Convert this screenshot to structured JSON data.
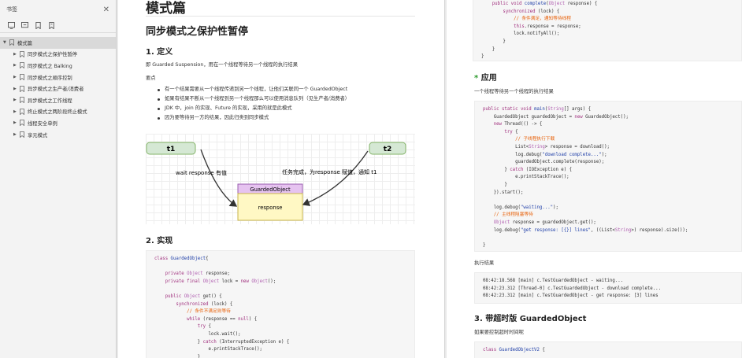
{
  "sidebar": {
    "title": "书签",
    "items": [
      {
        "label": "模式篇",
        "level": 0,
        "selected": true
      },
      {
        "label": "同步模式之保护性暂停",
        "level": 1
      },
      {
        "label": "同步模式之 Balking",
        "level": 1
      },
      {
        "label": "同步模式之顺序控制",
        "level": 1
      },
      {
        "label": "异步模式之生产者/消费者",
        "level": 1
      },
      {
        "label": "异步模式之工作线程",
        "level": 1
      },
      {
        "label": "终止模式之两阶段终止模式",
        "level": 1
      },
      {
        "label": "线程安全单例",
        "level": 1
      },
      {
        "label": "享元模式",
        "level": 1
      }
    ]
  },
  "left": {
    "h1": "模式篇",
    "h2": "同步模式之保护性暂停",
    "def_title": "1. 定义",
    "def_text": "即 Guarded Suspension，用在一个线程等待另一个线程的执行结果",
    "points_title": "要点",
    "bullets": [
      "有一个结果需要从一个线程传递到另一个线程，让他们关联同一个 GuardedObject",
      "如果有结果不断从一个线程到另一个线程那么可以使用消息队列（见生产者/消费者）",
      "JDK 中，join 的实现、Future 的实现，采用的就是此模式",
      "因为要等待另一方的结果，因此归类到同步模式"
    ],
    "impl_title": "2. 实现"
  },
  "diagram": {
    "t1": "t1",
    "t2": "t2",
    "class_name": "GuardedObject",
    "field": "response",
    "left_label": "wait response 有值",
    "right_label": "任务完成，为response 赋值，通知 t1"
  },
  "code_left": [
    [
      [
        "kw",
        "class "
      ],
      [
        "fn",
        "GuardedObject"
      ],
      [
        "",
        "{"
      ]
    ],
    [
      [
        "",
        ""
      ]
    ],
    [
      [
        "",
        "    "
      ],
      [
        "kw",
        "private "
      ],
      [
        "ty",
        "Object "
      ],
      [
        "",
        "response;"
      ]
    ],
    [
      [
        "",
        "    "
      ],
      [
        "kw",
        "private final "
      ],
      [
        "ty",
        "Object "
      ],
      [
        "",
        "lock = "
      ],
      [
        "kw",
        "new "
      ],
      [
        "ty",
        "Object"
      ],
      [
        "",
        "();"
      ]
    ],
    [
      [
        "",
        ""
      ]
    ],
    [
      [
        "",
        "    "
      ],
      [
        "kw",
        "public "
      ],
      [
        "ty",
        "Object "
      ],
      [
        "",
        "get() {"
      ]
    ],
    [
      [
        "",
        "        "
      ],
      [
        "kw",
        "synchronized "
      ],
      [
        "",
        "(lock) {"
      ]
    ],
    [
      [
        "",
        "            "
      ],
      [
        "cm",
        "// 条件不满足则等待"
      ]
    ],
    [
      [
        "",
        "            "
      ],
      [
        "kw",
        "while "
      ],
      [
        "",
        "(response == "
      ],
      [
        "kw",
        "null"
      ],
      [
        "",
        ") {"
      ]
    ],
    [
      [
        "",
        "                "
      ],
      [
        "kw",
        "try "
      ],
      [
        "",
        "{"
      ]
    ],
    [
      [
        "",
        "                    lock.wait();"
      ]
    ],
    [
      [
        "",
        "                } "
      ],
      [
        "kw",
        "catch "
      ],
      [
        "",
        "(InterruptedException e) {"
      ]
    ],
    [
      [
        "",
        "                    e.printStackTrace();"
      ]
    ],
    [
      [
        "",
        "                }"
      ]
    ]
  ],
  "right": {
    "app_title": "应用",
    "app_text": "一个线程等待另一个线程的执行结果",
    "result_label": "执行结果",
    "timeout_title": "3. 带超时版 GuardedObject",
    "timeout_text": "如果要控制超时时间呢"
  },
  "code_right_top": [
    [
      [
        "",
        "    "
      ],
      [
        "kw",
        "public void "
      ],
      [
        "fn",
        "complete"
      ],
      [
        "",
        "("
      ],
      [
        "ty",
        "Object "
      ],
      [
        "",
        "response) {"
      ]
    ],
    [
      [
        "",
        "        "
      ],
      [
        "kw",
        "synchronized "
      ],
      [
        "",
        "(lock) {"
      ]
    ],
    [
      [
        "",
        "            "
      ],
      [
        "cm",
        "// 条件满足，通知等待线程"
      ]
    ],
    [
      [
        "",
        "            "
      ],
      [
        "kw",
        "this"
      ],
      [
        "",
        ".response = response;"
      ]
    ],
    [
      [
        "",
        "            lock.notifyAll();"
      ]
    ],
    [
      [
        "",
        "        }"
      ]
    ],
    [
      [
        "",
        "    }"
      ]
    ],
    [
      [
        "",
        "}"
      ]
    ]
  ],
  "code_right_app": [
    [
      [
        "kw",
        "public static void "
      ],
      [
        "fn",
        "main"
      ],
      [
        "",
        "("
      ],
      [
        "ty",
        "String"
      ],
      [
        "",
        "[] args) {"
      ]
    ],
    [
      [
        "",
        "    GuardedObject guardedObject = "
      ],
      [
        "kw",
        "new "
      ],
      [
        "",
        "GuardedObject();"
      ]
    ],
    [
      [
        "",
        "    "
      ],
      [
        "kw",
        "new "
      ],
      [
        "",
        "Thread(() -> {"
      ]
    ],
    [
      [
        "",
        "        "
      ],
      [
        "kw",
        "try "
      ],
      [
        "",
        "{"
      ]
    ],
    [
      [
        "",
        "            "
      ],
      [
        "cm",
        "// 子线程执行下载"
      ]
    ],
    [
      [
        "",
        "            List<"
      ],
      [
        "ty",
        "String"
      ],
      [
        "",
        "> response = download();"
      ]
    ],
    [
      [
        "",
        "            log.debug("
      ],
      [
        "st",
        "\"download complete...\""
      ],
      [
        "",
        ");"
      ]
    ],
    [
      [
        "",
        "            guardedObject.complete(response);"
      ]
    ],
    [
      [
        "",
        "        } "
      ],
      [
        "kw",
        "catch "
      ],
      [
        "",
        "(IOException e) {"
      ]
    ],
    [
      [
        "",
        "            e.printStackTrace();"
      ]
    ],
    [
      [
        "",
        "        }"
      ]
    ],
    [
      [
        "",
        "    }).start();"
      ]
    ],
    [
      [
        "",
        ""
      ]
    ],
    [
      [
        "",
        "    log.debug("
      ],
      [
        "st",
        "\"waiting...\""
      ],
      [
        "",
        ");"
      ]
    ],
    [
      [
        "",
        "    "
      ],
      [
        "cm",
        "// 主线程阻塞等待"
      ]
    ],
    [
      [
        "",
        "    "
      ],
      [
        "ty",
        "Object "
      ],
      [
        "",
        "response = guardedObject.get();"
      ]
    ],
    [
      [
        "",
        "    log.debug("
      ],
      [
        "st",
        "\"get response: [{}] lines\""
      ],
      [
        "",
        ", ((List<"
      ],
      [
        "ty",
        "String"
      ],
      [
        "",
        ">) response).size());"
      ]
    ],
    [
      [
        "",
        ""
      ]
    ],
    [
      [
        "",
        "}"
      ]
    ]
  ],
  "output_lines": [
    "08:42:18.568 [main] c.TestGuardedObject - waiting...",
    "08:42:23.312 [Thread-0] c.TestGuardedObject - download complete...",
    "08:42:23.312 [main] c.TestGuardedObject - get response: [3] lines"
  ],
  "code_right_bottom": [
    [
      [
        "kw",
        "class "
      ],
      [
        "fn",
        "GuardedObjectV2"
      ],
      [
        "",
        " {"
      ]
    ]
  ],
  "colors": {
    "green": "#2c9a2c",
    "comment": "#e8620b",
    "keyword": "#a0307e"
  }
}
